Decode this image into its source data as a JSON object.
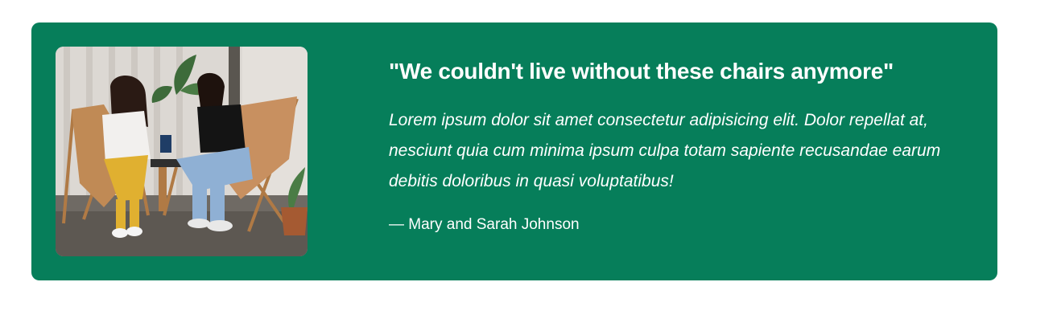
{
  "testimonial": {
    "image_alt": "Two women sitting in leather sling chairs",
    "headline": "\"We couldn't live without these chairs anymore\"",
    "quote": "Lorem ipsum dolor sit amet consectetur adipisicing elit. Dolor repellat at, nesciunt quia cum minima ipsum culpa totam sapiente recusandae earum debitis doloribus in quasi voluptatibus!",
    "author": "— Mary and Sarah Johnson"
  },
  "colors": {
    "card_background": "#067e5a",
    "text": "#ffffff",
    "page_background": "#ffffff"
  }
}
